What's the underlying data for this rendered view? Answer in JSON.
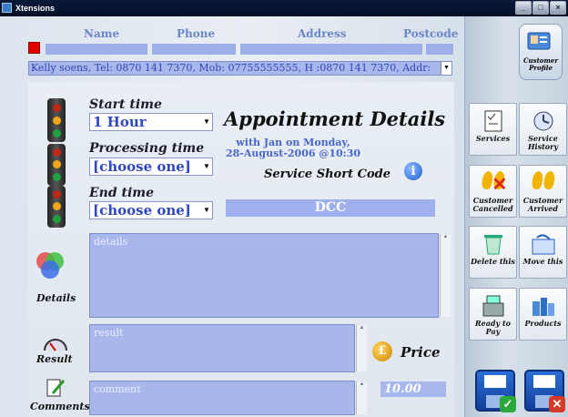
{
  "window": {
    "title": "Xtensions"
  },
  "columns": {
    "name": "Name",
    "phone": "Phone",
    "address": "Address",
    "postcode": "Postcode"
  },
  "customer_select": {
    "value": "Kelly soens, Tel: 0870 141 7370, Mob: 07755555555, H :0870 141 7370, Addr:"
  },
  "start_time": {
    "label": "Start time",
    "value": "1 Hour"
  },
  "processing_time": {
    "label": "Processing time",
    "value": "[choose one]"
  },
  "end_time": {
    "label": "End time",
    "value": "[choose one]"
  },
  "appointment": {
    "title": "Appointment Details",
    "with_line1": "with Jan on Monday,",
    "with_line2": "28-August-2006 @10:30",
    "short_code_label": "Service Short Code",
    "short_code_value": "DCC"
  },
  "details": {
    "label": "Details",
    "placeholder": "details"
  },
  "result": {
    "label": "Result",
    "placeholder": "result"
  },
  "comments": {
    "label": "Comments",
    "placeholder": "comment"
  },
  "price": {
    "label": "Price",
    "value": "10.00"
  },
  "sidebar": {
    "customer_profile": "Customer Profile",
    "services": "Services",
    "service_history": "Service History",
    "customer_cancelled": "Customer Cancelled",
    "customer_arrived": "Customer Arrived",
    "delete_this": "Delete this",
    "move_this": "Move this",
    "ready_to_pay": "Ready to Pay",
    "products": "Products"
  },
  "colors": {
    "field_fill": "#a8b6ec",
    "accent_text": "#3048c0",
    "header_text": "#6a86c8"
  }
}
